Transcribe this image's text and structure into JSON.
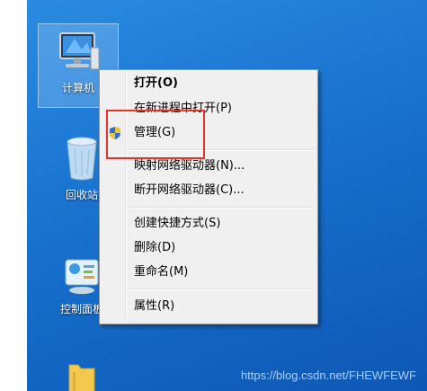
{
  "desktop": {
    "icons": [
      {
        "label": "计算机",
        "icon": "computer-icon"
      },
      {
        "label": "回收站",
        "icon": "recycle-bin-icon"
      },
      {
        "label": "控制面板",
        "icon": "control-panel-icon"
      },
      {
        "label": "",
        "icon": "folder-icon"
      }
    ]
  },
  "context_menu": {
    "items": [
      {
        "label": "打开(O)",
        "bold": true
      },
      {
        "label": "在新进程中打开(P)"
      },
      {
        "label": "管理(G)",
        "icon": "uac-shield-icon"
      },
      {
        "label": "映射网络驱动器(N)..."
      },
      {
        "label": "断开网络驱动器(C)..."
      },
      {
        "label": "创建快捷方式(S)"
      },
      {
        "label": "删除(D)"
      },
      {
        "label": "重命名(M)"
      },
      {
        "label": "属性(R)"
      }
    ]
  },
  "annotation": {
    "color": "#e8332a"
  },
  "watermark": "https://blog.csdn.net/FHEWFEWF",
  "colors": {
    "desktop": "#1a74d0",
    "menu_bg": "#f0f0f0"
  }
}
